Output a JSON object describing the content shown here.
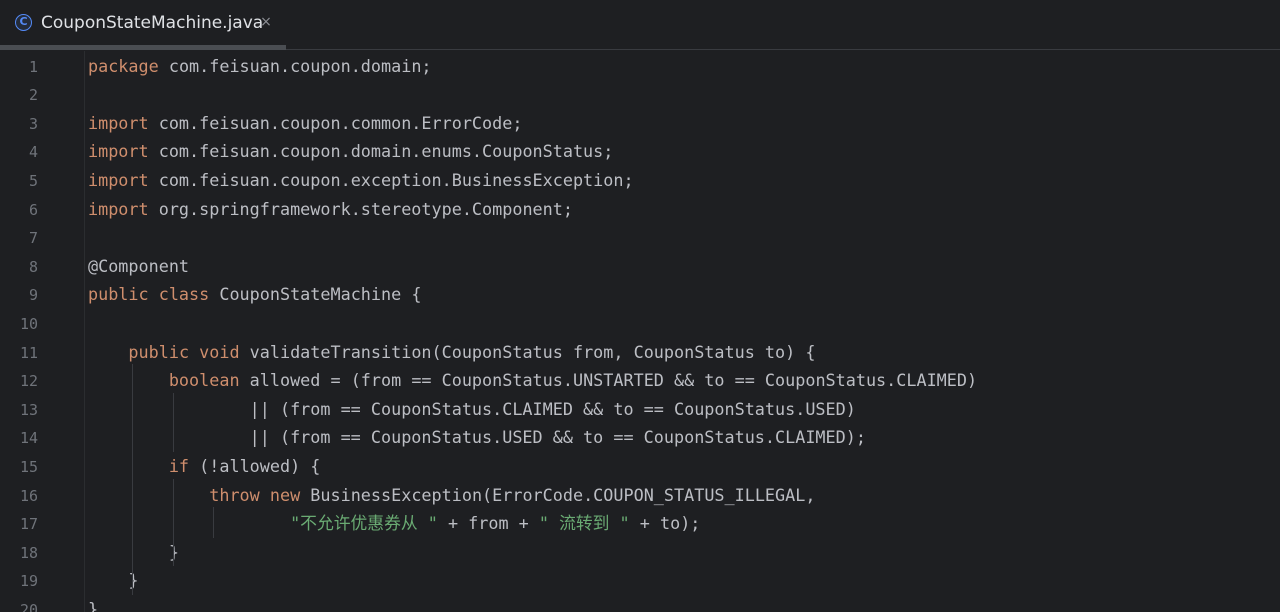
{
  "tab": {
    "label": "CouponStateMachine.java",
    "icon": "java-class-icon",
    "icon_glyph": "C",
    "close_glyph": "×"
  },
  "colors": {
    "keyword": "#CF8E6D",
    "plain": "#BCBEC4",
    "string": "#6AAB73",
    "line_number": "#6F737A",
    "background": "#1E1F22",
    "accent": "#548AF7"
  },
  "code": {
    "lines": [
      {
        "number": "1",
        "tokens": [
          {
            "t": "kw",
            "v": "package"
          },
          {
            "t": "plain",
            "v": " com.feisuan.coupon.domain;"
          }
        ]
      },
      {
        "number": "2",
        "tokens": []
      },
      {
        "number": "3",
        "tokens": [
          {
            "t": "kw",
            "v": "import"
          },
          {
            "t": "plain",
            "v": " com.feisuan.coupon.common.ErrorCode;"
          }
        ]
      },
      {
        "number": "4",
        "tokens": [
          {
            "t": "kw",
            "v": "import"
          },
          {
            "t": "plain",
            "v": " com.feisuan.coupon.domain.enums.CouponStatus;"
          }
        ]
      },
      {
        "number": "5",
        "tokens": [
          {
            "t": "kw",
            "v": "import"
          },
          {
            "t": "plain",
            "v": " com.feisuan.coupon.exception.BusinessException;"
          }
        ]
      },
      {
        "number": "6",
        "tokens": [
          {
            "t": "kw",
            "v": "import"
          },
          {
            "t": "plain",
            "v": " org.springframework.stereotype.Component;"
          }
        ]
      },
      {
        "number": "7",
        "tokens": []
      },
      {
        "number": "8",
        "tokens": [
          {
            "t": "plain",
            "v": "@Component"
          }
        ]
      },
      {
        "number": "9",
        "tokens": [
          {
            "t": "kw",
            "v": "public class"
          },
          {
            "t": "plain",
            "v": " CouponStateMachine {"
          }
        ]
      },
      {
        "number": "10",
        "tokens": []
      },
      {
        "number": "11",
        "tokens": [
          {
            "t": "plain",
            "v": "    "
          },
          {
            "t": "kw",
            "v": "public void"
          },
          {
            "t": "plain",
            "v": " validateTransition(CouponStatus from, CouponStatus to) {"
          }
        ]
      },
      {
        "number": "12",
        "tokens": [
          {
            "t": "plain",
            "v": "        "
          },
          {
            "t": "kw",
            "v": "boolean"
          },
          {
            "t": "plain",
            "v": " allowed = (from == CouponStatus.UNSTARTED && to == CouponStatus.CLAIMED)"
          }
        ]
      },
      {
        "number": "13",
        "tokens": [
          {
            "t": "plain",
            "v": "                || (from == CouponStatus.CLAIMED && to == CouponStatus.USED)"
          }
        ]
      },
      {
        "number": "14",
        "tokens": [
          {
            "t": "plain",
            "v": "                || (from == CouponStatus.USED && to == CouponStatus.CLAIMED);"
          }
        ]
      },
      {
        "number": "15",
        "tokens": [
          {
            "t": "plain",
            "v": "        "
          },
          {
            "t": "kw",
            "v": "if"
          },
          {
            "t": "plain",
            "v": " (!allowed) {"
          }
        ]
      },
      {
        "number": "16",
        "tokens": [
          {
            "t": "plain",
            "v": "            "
          },
          {
            "t": "kw",
            "v": "throw new"
          },
          {
            "t": "plain",
            "v": " BusinessException(ErrorCode.COUPON_STATUS_ILLEGAL,"
          }
        ]
      },
      {
        "number": "17",
        "tokens": [
          {
            "t": "plain",
            "v": "                    "
          },
          {
            "t": "str",
            "v": "\"不允许优惠券从 \""
          },
          {
            "t": "plain",
            "v": " + from + "
          },
          {
            "t": "str",
            "v": "\" 流转到 \""
          },
          {
            "t": "plain",
            "v": " + to);"
          }
        ]
      },
      {
        "number": "18",
        "tokens": [
          {
            "t": "plain",
            "v": "        }"
          }
        ]
      },
      {
        "number": "19",
        "tokens": [
          {
            "t": "plain",
            "v": "    }"
          }
        ]
      },
      {
        "number": "20",
        "tokens": [
          {
            "t": "plain",
            "v": "}"
          }
        ]
      }
    ]
  }
}
